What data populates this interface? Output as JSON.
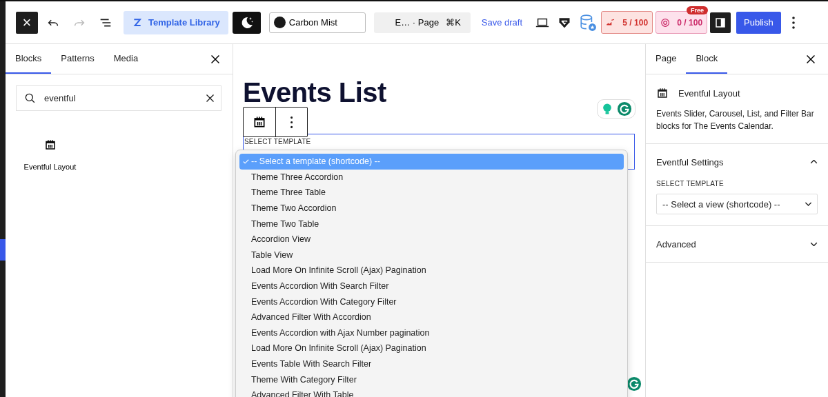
{
  "toolbar": {
    "close": {
      "label": "×"
    },
    "undo": {
      "disabled": false
    },
    "redo": {
      "disabled": true
    },
    "template_library": {
      "label": "Template Library"
    },
    "style_picker": {
      "label": "Carbon Mist"
    },
    "command": {
      "label": "E… · Page",
      "shortcut": "⌘K"
    },
    "save_draft": "Save draft",
    "counters": [
      {
        "kind": "chart",
        "value": "5 / 100"
      },
      {
        "kind": "mail",
        "value": "0 / 100",
        "badge": "Free"
      }
    ],
    "publish": "Publish"
  },
  "inserter": {
    "tabs": [
      {
        "label": "Blocks",
        "selected": true
      },
      {
        "label": "Patterns",
        "selected": false
      },
      {
        "label": "Media",
        "selected": false
      }
    ],
    "search": {
      "value": "eventful"
    },
    "blocks": [
      {
        "label": "Eventful Layout"
      }
    ]
  },
  "canvas": {
    "title": "Events List",
    "field_label": "SELECT TEMPLATE",
    "options": [
      {
        "label": "-- Select a template (shortcode) --",
        "selected": true
      },
      {
        "label": "Theme Three Accordion",
        "selected": false
      },
      {
        "label": "Theme Three Table",
        "selected": false
      },
      {
        "label": "Theme Two Accordion",
        "selected": false
      },
      {
        "label": "Theme Two Table",
        "selected": false
      },
      {
        "label": "Accordion View",
        "selected": false
      },
      {
        "label": "Table View",
        "selected": false
      },
      {
        "label": "Load More On Infinite Scroll (Ajax) Pagination",
        "selected": false
      },
      {
        "label": "Events Accordion With Search Filter",
        "selected": false
      },
      {
        "label": "Events Accordion With Category Filter",
        "selected": false
      },
      {
        "label": "Advanced Filter With Accordion",
        "selected": false
      },
      {
        "label": "Events Accordion with Ajax Number pagination",
        "selected": false
      },
      {
        "label": "Load More On Infinite Scroll (Ajax) Pagination",
        "selected": false
      },
      {
        "label": "Events Table With Search Filter",
        "selected": false
      },
      {
        "label": "Theme With Category Filter",
        "selected": false
      },
      {
        "label": "Advanced Filter With Table",
        "selected": false
      }
    ]
  },
  "settings": {
    "tabs": [
      {
        "label": "Page",
        "selected": false
      },
      {
        "label": "Block",
        "selected": true
      }
    ],
    "block": {
      "name": "Eventful Layout",
      "description": "Events Slider, Carousel, List, and Filter Bar blocks for The Events Calendar."
    },
    "panels": [
      {
        "title": "Eventful Settings",
        "expanded": true,
        "field_label": "SELECT TEMPLATE",
        "select": "-- Select a view (shortcode) --"
      },
      {
        "title": "Advanced",
        "expanded": false
      }
    ]
  }
}
